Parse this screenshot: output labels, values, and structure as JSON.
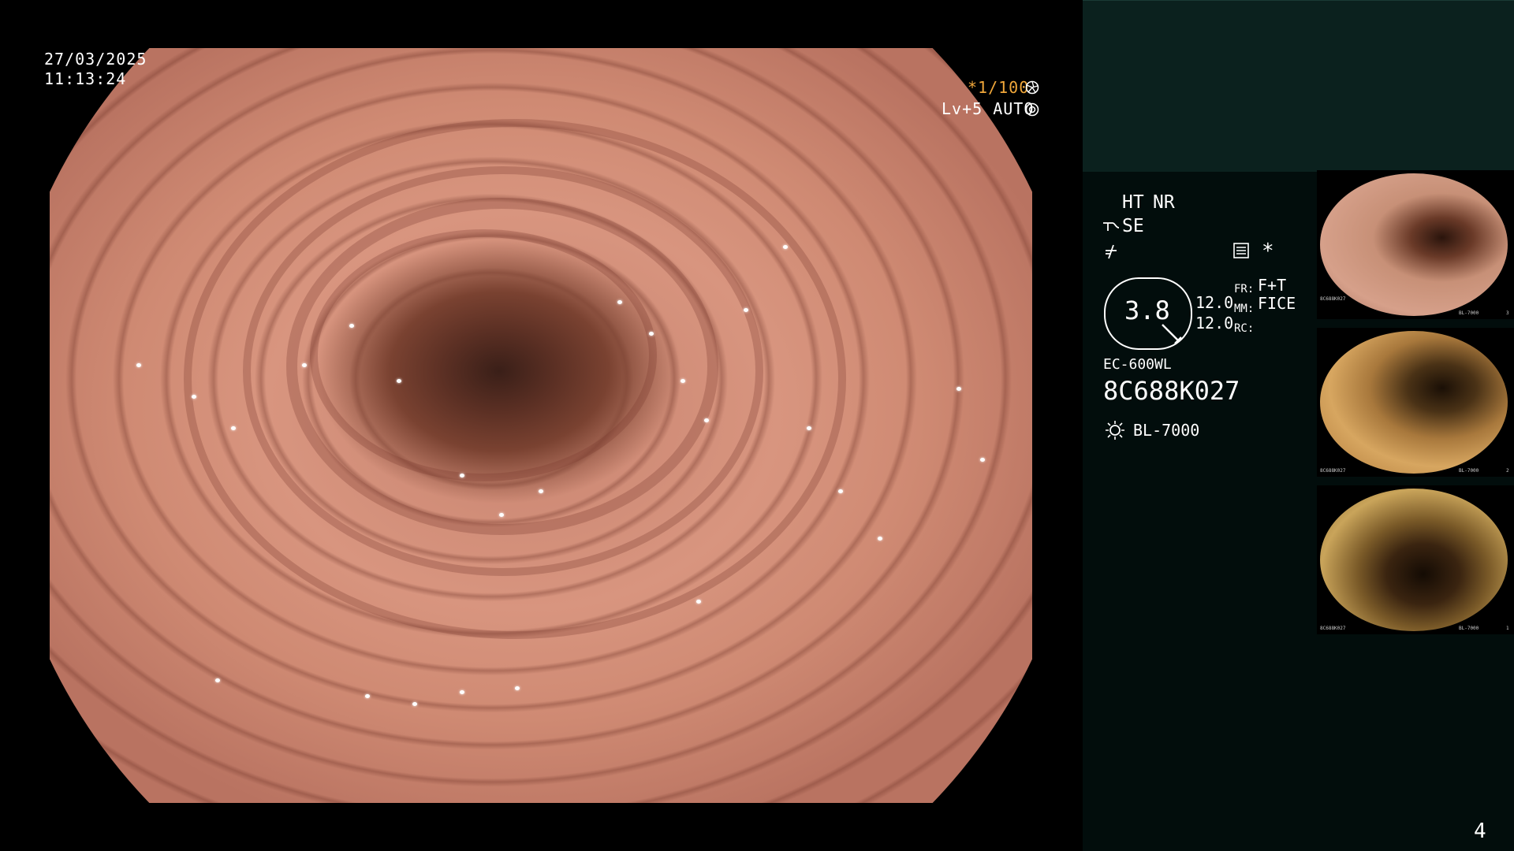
{
  "overlay": {
    "date": "27/03/2025",
    "time": "11:13:24",
    "shutter": "*1/100",
    "light_level": "Lv+5 AUTO"
  },
  "panel": {
    "mode_ht": "HT",
    "mode_nr": "NR",
    "mode_se": "SE",
    "magnification": "3.8",
    "fr_label": "FR:",
    "fr_value": "F+T",
    "mm_label": "MM:",
    "mm_value": "FICE",
    "rc_label": "RC:",
    "value_a": "12.0",
    "value_b": "12.0",
    "scope_model": "EC-600WL",
    "serial": "8C688K027",
    "light_source": "BL-7000",
    "asterisk": "*"
  },
  "thumbnails": [
    {
      "caption": "8C688K027",
      "footer": "BL-7000",
      "index": "3",
      "tone": "#c08a6a"
    },
    {
      "caption": "8C688K027",
      "footer": "BL-7000",
      "index": "2",
      "tone": "#c79a4e"
    },
    {
      "caption": "8C688K027",
      "footer": "BL-7000",
      "index": "1",
      "tone": "#9a7438"
    }
  ],
  "page_number": "4",
  "colors": {
    "accent": "#f0a73a",
    "panel_bg": "#020d0c",
    "panel_header": "#0b211e"
  },
  "icons": [
    "aperture-icon",
    "iris-icon",
    "structure-enhance-icon",
    "contrast-icon",
    "memory-card-icon",
    "lamp-icon"
  ]
}
